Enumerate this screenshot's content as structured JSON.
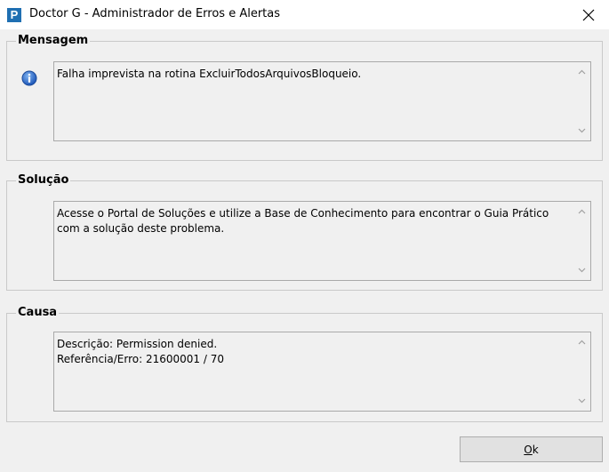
{
  "window": {
    "title": "Doctor G - Administrador de Erros e Alertas",
    "app_icon_letter": "P",
    "icons": {
      "app": "app-icon",
      "close": "close-icon",
      "info": "info-icon",
      "scroll_up": "chevron-up-icon",
      "scroll_down": "chevron-down-icon"
    },
    "accent_color": "#1f6fb2"
  },
  "mensagem": {
    "label": "Mensagem",
    "text": "Falha imprevista na rotina ExcluirTodosArquivosBloqueio."
  },
  "solucao": {
    "label": "Solução",
    "text": "Acesse o Portal de Soluções e utilize a Base de Conhecimento para encontrar o Guia Prático com a solução deste problema."
  },
  "causa": {
    "label": "Causa",
    "text": "Descrição: Permission denied.\nReferência/Erro: 21600001 / 70"
  },
  "buttons": {
    "ok_mnemonic": "O",
    "ok_rest": "k"
  }
}
